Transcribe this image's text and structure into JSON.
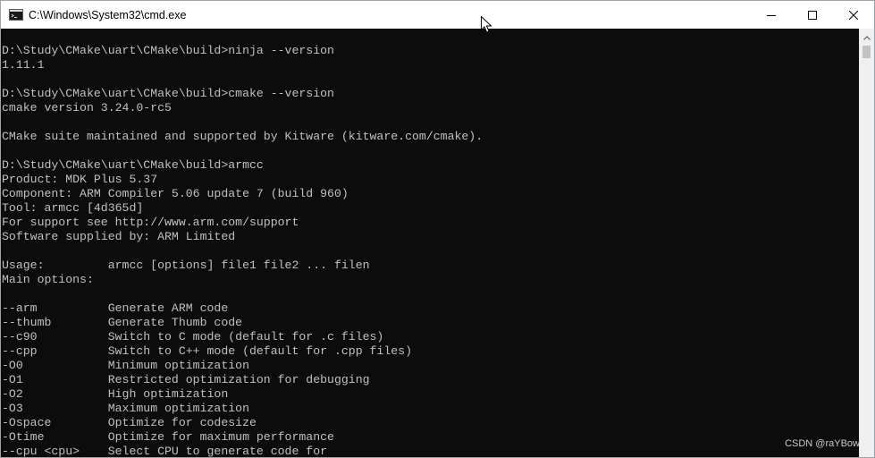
{
  "window": {
    "title": "C:\\Windows\\System32\\cmd.exe",
    "icon": "cmd-icon"
  },
  "controls": {
    "minimize_icon": "minimize-icon",
    "maximize_icon": "maximize-icon",
    "close_icon": "close-icon"
  },
  "console": {
    "lines": [
      "D:\\Study\\CMake\\uart\\CMake\\build>ninja --version",
      "1.11.1",
      "",
      "D:\\Study\\CMake\\uart\\CMake\\build>cmake --version",
      "cmake version 3.24.0-rc5",
      "",
      "CMake suite maintained and supported by Kitware (kitware.com/cmake).",
      "",
      "D:\\Study\\CMake\\uart\\CMake\\build>armcc",
      "Product: MDK Plus 5.37",
      "Component: ARM Compiler 5.06 update 7 (build 960)",
      "Tool: armcc [4d365d]",
      "For support see http://www.arm.com/support",
      "Software supplied by: ARM Limited",
      "",
      "Usage:         armcc [options] file1 file2 ... filen",
      "Main options:",
      "",
      "--arm          Generate ARM code",
      "--thumb        Generate Thumb code",
      "--c90          Switch to C mode (default for .c files)",
      "--cpp          Switch to C++ mode (default for .cpp files)",
      "-O0            Minimum optimization",
      "-O1            Restricted optimization for debugging",
      "-O2            High optimization",
      "-O3            Maximum optimization",
      "-Ospace        Optimize for codesize",
      "-Otime         Optimize for maximum performance",
      "--cpu <cpu>    Select CPU to generate code for"
    ]
  },
  "watermark": "CSDN @raYBow",
  "colors": {
    "console_bg": "#0c0c0c",
    "console_fg": "#c0c0c0",
    "titlebar_bg": "#ffffff"
  }
}
